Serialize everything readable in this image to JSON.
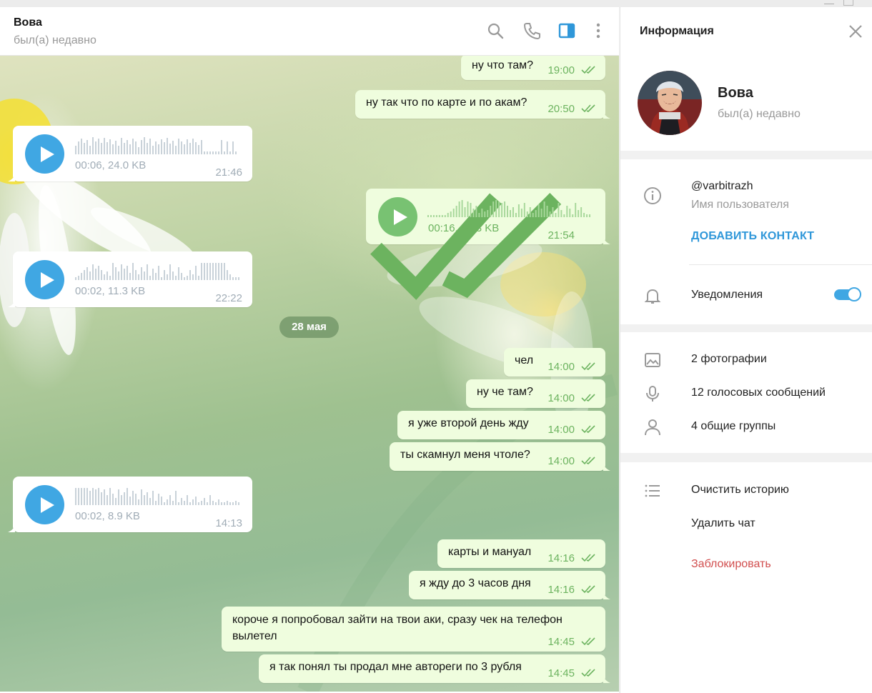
{
  "window": {
    "minimize_icon": "minimize-icon",
    "maximize_icon": "maximize-icon"
  },
  "chat": {
    "name": "Вова",
    "status": "был(а) недавно",
    "header_icons": [
      "search-icon",
      "phone-icon",
      "sidebar-toggle-icon",
      "more-vert-icon"
    ],
    "date_separator": "28 мая",
    "messages": [
      {
        "id": "m1",
        "kind": "text",
        "dir": "out",
        "text": "ну что там?",
        "time": "19:00"
      },
      {
        "id": "m2",
        "kind": "text",
        "dir": "out",
        "text": "ну так что по карте и по акам?",
        "time": "20:50"
      },
      {
        "id": "v1",
        "kind": "voice",
        "dir": "in",
        "meta": "00:06, 24.0 KB",
        "time": "21:46"
      },
      {
        "id": "v2",
        "kind": "voice",
        "dir": "out",
        "meta": "00:16, 69.3 KB",
        "time": "21:54"
      },
      {
        "id": "v3",
        "kind": "voice",
        "dir": "in",
        "meta": "00:02, 11.3 KB",
        "time": "22:22"
      },
      {
        "id": "m3",
        "kind": "text",
        "dir": "out",
        "text": "чел",
        "time": "14:00"
      },
      {
        "id": "m4",
        "kind": "text",
        "dir": "out",
        "text": "ну че там?",
        "time": "14:00"
      },
      {
        "id": "m5",
        "kind": "text",
        "dir": "out",
        "text": "я уже второй день жду",
        "time": "14:00"
      },
      {
        "id": "m6",
        "kind": "text",
        "dir": "out",
        "text": "ты скамнул меня чтоле?",
        "time": "14:00"
      },
      {
        "id": "v4",
        "kind": "voice",
        "dir": "in",
        "meta": "00:02, 8.9 KB",
        "time": "14:13"
      },
      {
        "id": "m7",
        "kind": "text",
        "dir": "out",
        "text": "карты и мануал",
        "time": "14:16"
      },
      {
        "id": "m8",
        "kind": "text",
        "dir": "out",
        "text": "я жду до 3 часов дня",
        "time": "14:16"
      },
      {
        "id": "m9",
        "kind": "text",
        "dir": "out",
        "text_line1": "короче я попробовал зайти на твои аки, сразу чек на телефон",
        "text_line2": "вылетел",
        "time": "14:45"
      },
      {
        "id": "m10",
        "kind": "text",
        "dir": "out",
        "text": "я так понял ты продал мне автореги по 3 рубля",
        "time": "14:45"
      }
    ]
  },
  "info": {
    "title": "Информация",
    "close_icon": "close-icon",
    "profile": {
      "name": "Вова",
      "status": "был(а) недавно"
    },
    "username": "@varbitrazh",
    "username_label": "Имя пользователя",
    "add_contact": "ДОБАВИТЬ КОНТАКТ",
    "notifications_label": "Уведомления",
    "notifications_on": true,
    "media": {
      "photos": "2 фотографии",
      "voice": "12 голосовых сообщений",
      "groups": "4 общие группы"
    },
    "actions": {
      "clear": "Очистить историю",
      "delete": "Удалить чат",
      "block": "Заблокировать"
    },
    "colors": {
      "accent": "#40a7e3",
      "link": "#2f97d9",
      "danger": "#d14e4e",
      "outgoing_bubble": "#effdde",
      "outgoing_time": "#6cb35f"
    }
  }
}
